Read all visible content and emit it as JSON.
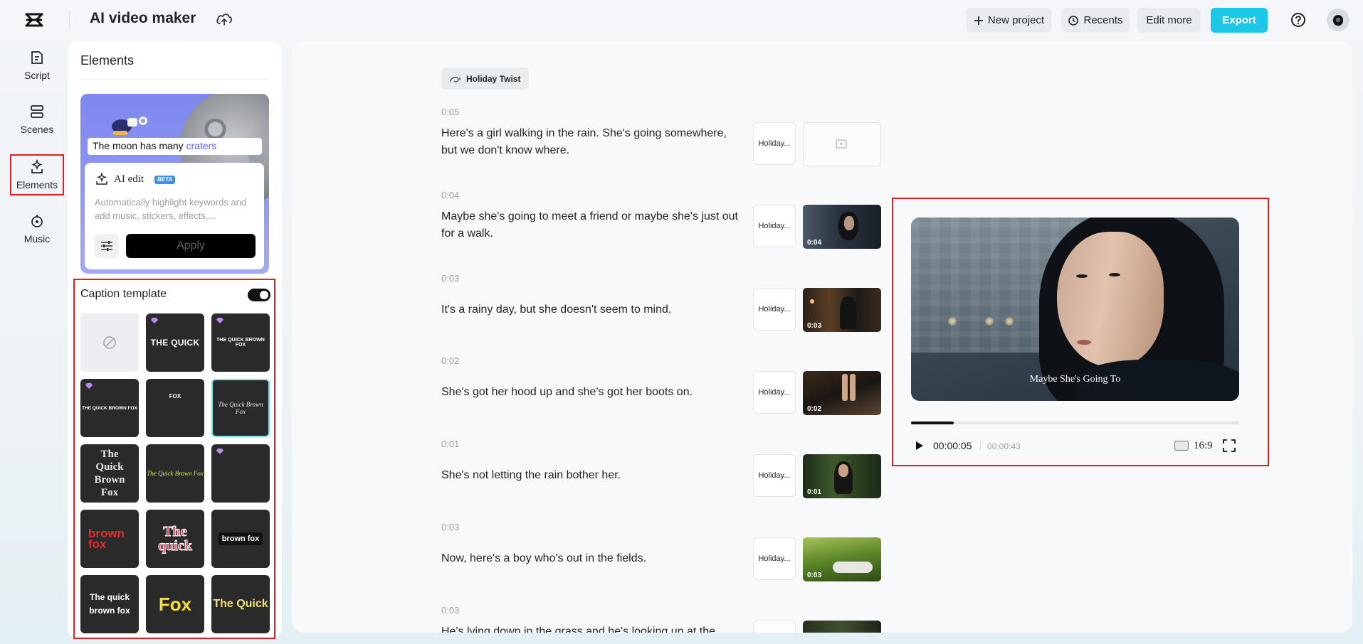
{
  "app": {
    "title": "AI video maker"
  },
  "header": {
    "new_project": "New project",
    "recents": "Recents",
    "edit_more": "Edit more",
    "export": "Export",
    "accent": "#1ac7e6"
  },
  "nav": [
    {
      "label": "Script",
      "icon": "script-icon"
    },
    {
      "label": "Scenes",
      "icon": "scenes-icon"
    },
    {
      "label": "Elements",
      "icon": "elements-icon",
      "active": true
    },
    {
      "label": "Music",
      "icon": "music-icon"
    }
  ],
  "panel": {
    "title": "Elements",
    "promo": {
      "caption_prefix": "The moon has many ",
      "caption_highlight": "craters",
      "ai_edit_title": "AI edit",
      "beta": "BETA",
      "description": "Automatically highlight keywords and add music, stickers, effects,...",
      "apply": "Apply"
    },
    "caption_template": {
      "title": "Caption template",
      "enabled": true,
      "templates": [
        {
          "text": "",
          "style": "none"
        },
        {
          "text": "THE QUICK",
          "premium": true
        },
        {
          "text": "THE QUICK BROWN FOX",
          "premium": true
        },
        {
          "text": "THE QUICK BROWN FOX",
          "premium": true
        },
        {
          "text": "FOX"
        },
        {
          "text": "The Quick Brown Fox",
          "selected": true
        },
        {
          "text": "The Quick Brown Fox"
        },
        {
          "text": "The Quick Brown Fox"
        },
        {
          "text": "",
          "premium": true
        },
        {
          "text": "brown fox"
        },
        {
          "text": "The quick"
        },
        {
          "text": "brown fox"
        },
        {
          "text": "The quick brown fox"
        },
        {
          "text": "Fox"
        },
        {
          "text": "The Quick"
        }
      ]
    }
  },
  "script": {
    "style_chip": "Holiday Twist",
    "scenes": [
      {
        "duration": "0:05",
        "text": "Here's a girl walking in the rain. She's going somewhere, but we don't know where.",
        "chip": "Holiday...",
        "media": "",
        "media_duration": ""
      },
      {
        "duration": "0:04",
        "text": "Maybe she's going to meet a friend or maybe she's just out for a walk.",
        "chip": "Holiday...",
        "media": "city-night",
        "media_duration": "0:04"
      },
      {
        "duration": "0:03",
        "text": "It's a rainy day, but she doesn't seem to mind.",
        "chip": "Holiday...",
        "media": "street-night",
        "media_duration": "0:03"
      },
      {
        "duration": "0:02",
        "text": "She's got her hood up and she's got her boots on.",
        "chip": "Holiday...",
        "media": "puddle",
        "media_duration": "0:02"
      },
      {
        "duration": "0:01",
        "text": "She's not letting the rain bother her.",
        "chip": "Holiday...",
        "media": "forest",
        "media_duration": "0:01"
      },
      {
        "duration": "0:03",
        "text": "Now, here's a boy who's out in the fields.",
        "chip": "Holiday...",
        "media": "grass-field",
        "media_duration": "0:03"
      },
      {
        "duration": "0:03",
        "text": "He's lying down in the grass and he's looking up at the",
        "chip": "",
        "media": "dark-forest",
        "media_duration": ""
      }
    ]
  },
  "preview": {
    "caption": "Maybe She's Going To",
    "current_time": "00:00:05",
    "total_time": "00:00:43",
    "progress": 0.13,
    "aspect_ratio": "16:9"
  }
}
